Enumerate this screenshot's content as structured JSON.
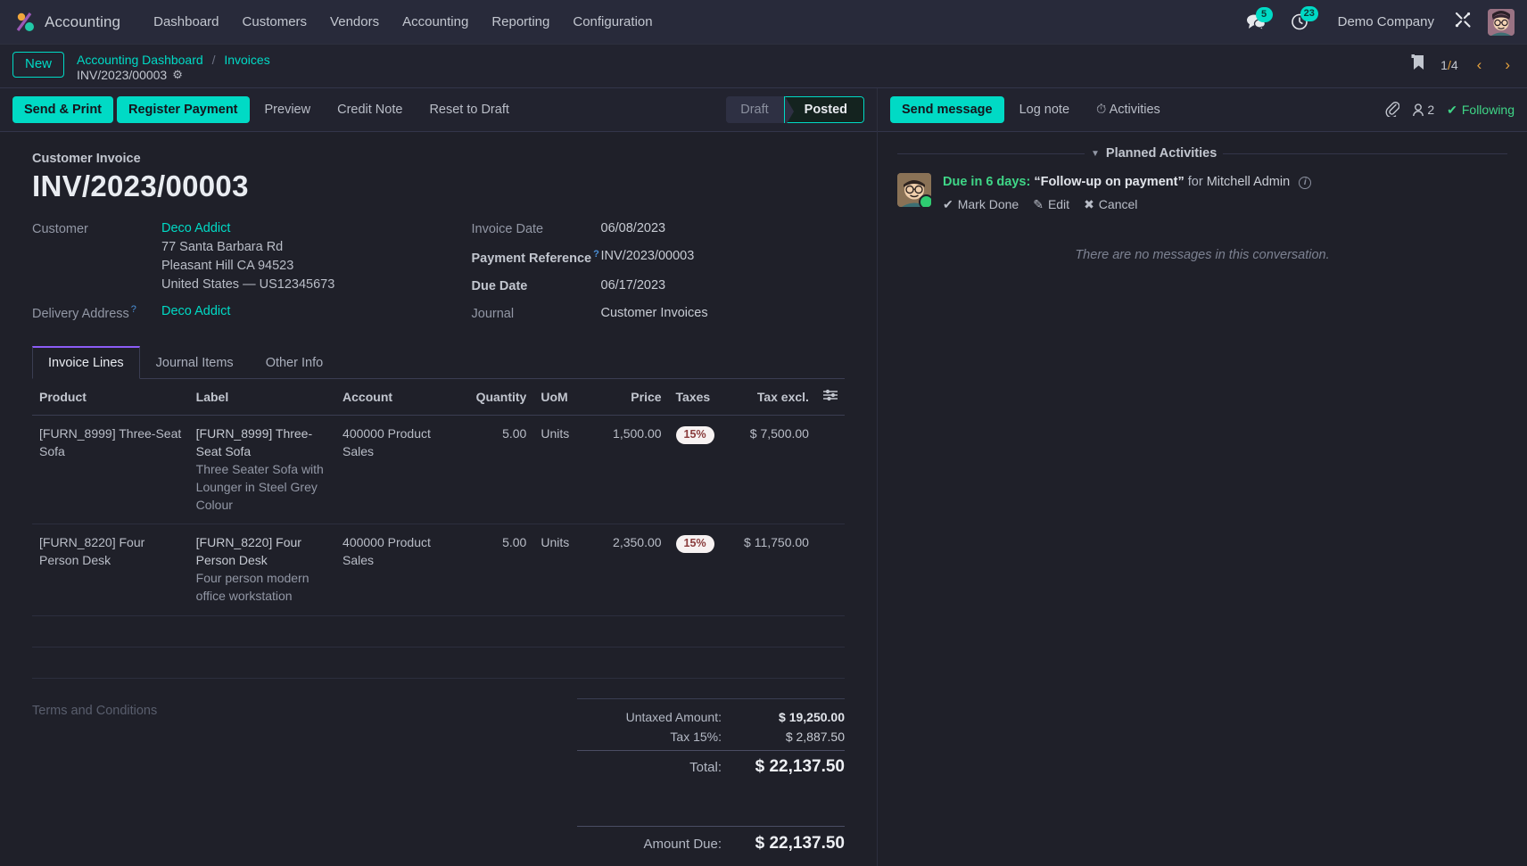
{
  "navbar": {
    "brand": "Accounting",
    "menu": [
      "Dashboard",
      "Customers",
      "Vendors",
      "Accounting",
      "Reporting",
      "Configuration"
    ],
    "messages_badge": "5",
    "activities_badge": "23",
    "company": "Demo Company",
    "icons": {
      "messages": "chat-icon",
      "activities": "clock-icon",
      "tools": "tools-icon",
      "avatar": "user-avatar"
    }
  },
  "control_panel": {
    "new_label": "New",
    "breadcrumb": {
      "root": "Accounting Dashboard",
      "separator": "/",
      "parent": "Invoices",
      "record": "INV/2023/00003"
    },
    "pager": {
      "current": "1",
      "sep": "/",
      "total": "4"
    }
  },
  "action_bar": {
    "buttons": [
      {
        "label": "Send & Print",
        "primary": true
      },
      {
        "label": "Register Payment",
        "primary": true
      },
      {
        "label": "Preview",
        "primary": false
      },
      {
        "label": "Credit Note",
        "primary": false
      },
      {
        "label": "Reset to Draft",
        "primary": false
      }
    ],
    "status_steps": [
      {
        "label": "Draft",
        "active": false
      },
      {
        "label": "Posted",
        "active": true
      }
    ]
  },
  "form": {
    "doc_type": "Customer Invoice",
    "title": "INV/2023/00003",
    "customer_label": "Customer",
    "customer_name": "Deco Addict",
    "customer_address": [
      "77 Santa Barbara Rd",
      "Pleasant Hill CA 94523",
      "United States — US12345673"
    ],
    "delivery_label": "Delivery Address",
    "delivery_value": "Deco Addict",
    "invoice_date_label": "Invoice Date",
    "invoice_date_value": "06/08/2023",
    "payment_ref_label": "Payment Reference",
    "payment_ref_value": "INV/2023/00003",
    "due_date_label": "Due Date",
    "due_date_value": "06/17/2023",
    "journal_label": "Journal",
    "journal_value": "Customer Invoices"
  },
  "notebook": {
    "tabs": [
      {
        "label": "Invoice Lines",
        "active": true
      },
      {
        "label": "Journal Items",
        "active": false
      },
      {
        "label": "Other Info",
        "active": false
      }
    ]
  },
  "lines_table": {
    "headers": {
      "product": "Product",
      "label": "Label",
      "account": "Account",
      "quantity": "Quantity",
      "uom": "UoM",
      "price": "Price",
      "taxes": "Taxes",
      "tax_excl": "Tax excl."
    },
    "optional_columns_icon": "sliders-icon",
    "rows": [
      {
        "product": "[FURN_8999] Three-Seat Sofa",
        "label_main": "[FURN_8999] Three-Seat Sofa",
        "label_desc": "Three Seater Sofa with Lounger in Steel Grey Colour",
        "account": "400000 Product Sales",
        "quantity": "5.00",
        "uom": "Units",
        "price": "1,500.00",
        "tax": "15%",
        "tax_excl": "$ 7,500.00"
      },
      {
        "product": "[FURN_8220] Four Person Desk",
        "label_main": "[FURN_8220] Four Person Desk",
        "label_desc": "Four person modern office workstation",
        "account": "400000 Product Sales",
        "quantity": "5.00",
        "uom": "Units",
        "price": "2,350.00",
        "tax": "15%",
        "tax_excl": "$ 11,750.00"
      }
    ]
  },
  "footer": {
    "terms_placeholder": "Terms and Conditions",
    "untaxed_label": "Untaxed Amount:",
    "untaxed_value": "$ 19,250.00",
    "tax_label": "Tax 15%:",
    "tax_value": "$ 2,887.50",
    "total_label": "Total:",
    "total_value": "$ 22,137.50",
    "amount_due_label": "Amount Due:",
    "amount_due_value": "$ 22,137.50"
  },
  "chatter": {
    "send_message": "Send message",
    "log_note": "Log note",
    "activities": "Activities",
    "follower_count": "2",
    "following_label": "Following",
    "planned_activities_title": "Planned Activities",
    "activity": {
      "due": "Due in 6 days:",
      "summary": "“Follow-up on payment”",
      "for_label": "for",
      "user": "Mitchell Admin",
      "mark_done": "Mark Done",
      "edit": "Edit",
      "cancel": "Cancel"
    },
    "no_messages": "There are no messages in this conversation."
  },
  "colors": {
    "accent": "#00dac5",
    "tab_active": "#8b5cf6",
    "following_green": "#3fd687",
    "pager_arrow": "#e8a33d",
    "tax_badge_bg": "#f7f2f2",
    "tax_badge_text": "#8a3c3c"
  }
}
